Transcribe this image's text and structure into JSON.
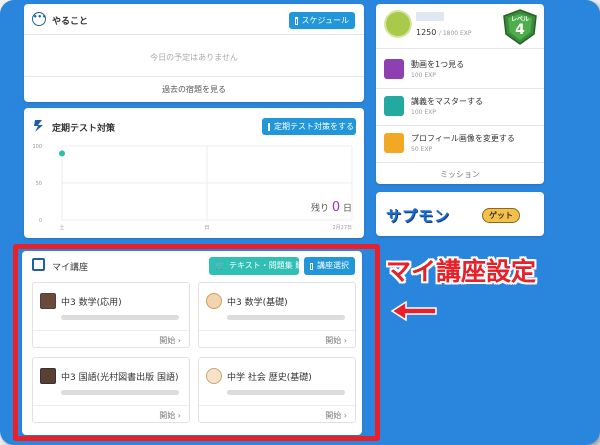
{
  "todo": {
    "title": "やること",
    "schedule_button": "スケジュール",
    "empty_message": "今日の予定はありません",
    "past_link": "過去の宿題を見る"
  },
  "test": {
    "title": "定期テスト対策",
    "button": "定期テスト対策をする",
    "remaining_label": "残り",
    "remaining_value": "0",
    "remaining_unit": "日"
  },
  "chart_data": {
    "type": "scatter",
    "y_ticks": [
      "100",
      "50",
      "0"
    ],
    "x_ticks": [
      "土",
      "日",
      "2月27日"
    ],
    "ylim": [
      0,
      100
    ],
    "points": [
      {
        "x": "土",
        "y": 90
      }
    ],
    "grid": true
  },
  "mycourses": {
    "title": "マイ講座",
    "buy_button": "テキスト・問題集 購入",
    "select_button": "講座選択",
    "courses": [
      {
        "name": "中3 数学(応用)",
        "start": "開始"
      },
      {
        "name": "中3 数学(基礎)",
        "start": "開始"
      },
      {
        "name": "中3 国語(光村図書出版 国語)",
        "start": "開始"
      },
      {
        "name": "中学 社会 歴史(基礎)",
        "start": "開始"
      }
    ]
  },
  "profile": {
    "exp": "1250",
    "exp_total": "/ 1800 EXP",
    "level_label": "レベル",
    "level": "4",
    "exp_progress": 0.69
  },
  "missions": {
    "items": [
      {
        "title": "動画を1つ見る",
        "exp": "100 EXP"
      },
      {
        "title": "講義をマスターする",
        "exp": "100 EXP"
      },
      {
        "title": "プロフィール画像を変更する",
        "exp": "50 EXP"
      }
    ],
    "footer": "ミッション"
  },
  "banner": {
    "logo": "サプモン",
    "badge": "ゲット"
  },
  "annotation": {
    "label": "マイ講座設定",
    "arrow": "←"
  },
  "colors": {
    "background": "#2a86dc",
    "button_blue": "#2196d8",
    "button_teal": "#2fbfb5",
    "highlight_red": "#e8202a",
    "chart_point": "#2bbfa3",
    "remaining_value": "#9b30c8"
  }
}
